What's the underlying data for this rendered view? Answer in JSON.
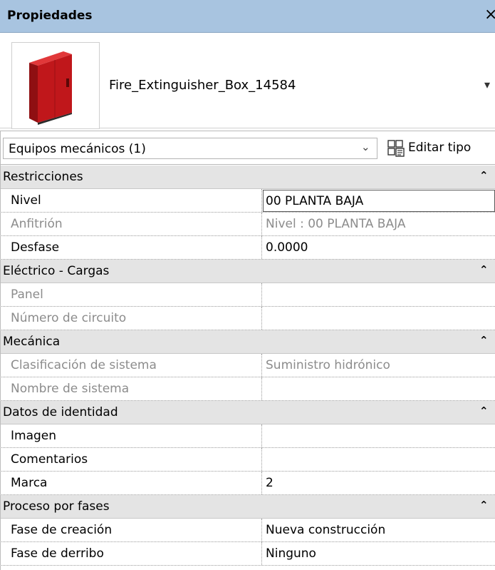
{
  "window": {
    "title": "Propiedades",
    "close_glyph": "×"
  },
  "type_selector": {
    "name": "Fire_Extinguisher_Box_14584",
    "thumbnail_icon": "fire-extinguisher-box-thumbnail",
    "arrow_glyph": "▾"
  },
  "category": {
    "selected": "Equipos mecánicos (1)",
    "dropdown_glyph": "⌄",
    "edit_type_label": "Editar tipo",
    "edit_type_icon": "edit-type-icon"
  },
  "groups": [
    {
      "title": "Restricciones",
      "props": [
        {
          "name": "Nivel",
          "value": "00 PLANTA BAJA",
          "readonly": false,
          "editing": true
        },
        {
          "name": "Anfitrión",
          "value": "Nivel : 00 PLANTA BAJA",
          "readonly": true
        },
        {
          "name": "Desfase",
          "value": "0.0000",
          "readonly": false
        }
      ]
    },
    {
      "title": "Eléctrico - Cargas",
      "props": [
        {
          "name": "Panel",
          "value": "",
          "readonly": true
        },
        {
          "name": "Número de circuito",
          "value": "",
          "readonly": true
        }
      ]
    },
    {
      "title": "Mecánica",
      "props": [
        {
          "name": "Clasificación de sistema",
          "value": "Suministro hidrónico",
          "readonly": true
        },
        {
          "name": "Nombre de sistema",
          "value": "",
          "readonly": true
        }
      ]
    },
    {
      "title": "Datos de identidad",
      "props": [
        {
          "name": "Imagen",
          "value": "",
          "readonly": false
        },
        {
          "name": "Comentarios",
          "value": "",
          "readonly": false
        },
        {
          "name": "Marca",
          "value": "2",
          "readonly": false
        }
      ]
    },
    {
      "title": "Proceso por fases",
      "props": [
        {
          "name": "Fase de creación",
          "value": "Nueva construcción",
          "readonly": false
        },
        {
          "name": "Fase de derribo",
          "value": "Ninguno",
          "readonly": false
        }
      ]
    }
  ],
  "collapse_glyph": "⌃",
  "colors": {
    "title_bar": "#a8c4e0",
    "group_bg": "#e4e4e4",
    "readonly_text": "#8c8c8c",
    "box_red": "#c0171b"
  }
}
